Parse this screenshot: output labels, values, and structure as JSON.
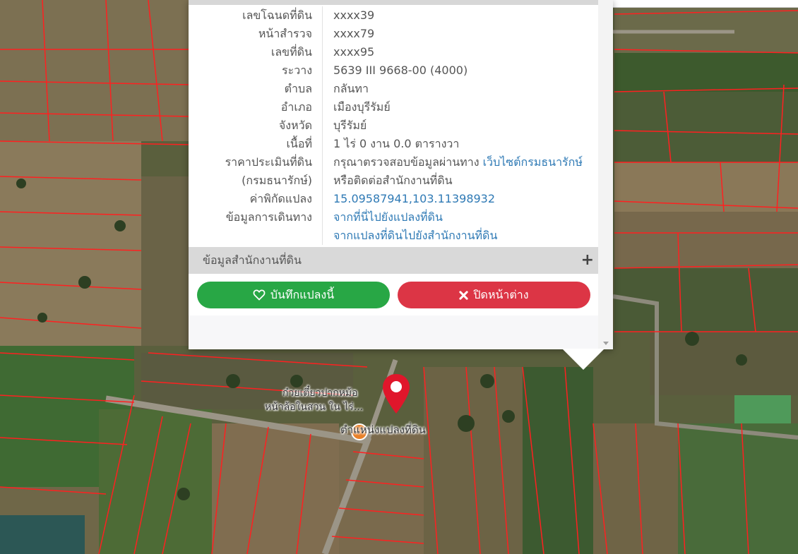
{
  "popup": {
    "rows": [
      {
        "label": "เลขโฉนดที่ดิน",
        "value": "xxxx39"
      },
      {
        "label": "หน้าสำรวจ",
        "value": "xxxx79"
      },
      {
        "label": "เลขที่ดิน",
        "value": "xxxx95"
      },
      {
        "label": "ระวาง",
        "value": "5639 III 9668-00 (4000)"
      },
      {
        "label": "ตำบล",
        "value": "กลันทา"
      },
      {
        "label": "อำเภอ",
        "value": "เมืองบุรีรัมย์"
      },
      {
        "label": "จังหวัด",
        "value": "บุรีรัมย์"
      },
      {
        "label": "เนื้อที่",
        "value": "1 ไร่ 0 งาน 0.0 ตารางวา"
      }
    ],
    "appraisal": {
      "label": "ราคาประเมินที่ดิน",
      "label2": "(กรมธนารักษ์)",
      "text": "กรุณาตรวจสอบข้อมูลผ่านทาง",
      "link": "เว็บไซต์กรมธนารักษ์",
      "text2": "หรือติดต่อสำนักงานที่ดิน"
    },
    "coordinates": {
      "label": "ค่าพิกัดแปลง",
      "value": "15.09587941,103.11398932"
    },
    "travel": {
      "label": "ข้อมูลการเดินทาง",
      "link1": "จากที่นี่ไปยังแปลงที่ดิน",
      "link2": "จากแปลงที่ดินไปยังสำนักงานที่ดิน"
    },
    "land_office_section": "ข้อมูลสำนักงานที่ดิน",
    "expand_symbol": "+",
    "save_button": "บันทึกแปลงนี้",
    "close_button": "ปิดหน้าต่าง"
  },
  "map": {
    "place_label_line1": "ก๋วยเตี๋ยวปากหม้อ",
    "place_label_line2": "หน้าล้อในสวน ใน ไร่...",
    "marker_label": "ตำแหน่งแปลงที่ดิน",
    "colors": {
      "parcel_lines": "#ff2020",
      "marker": "#e0162b",
      "save": "#28a745",
      "close": "#dc3545"
    }
  }
}
